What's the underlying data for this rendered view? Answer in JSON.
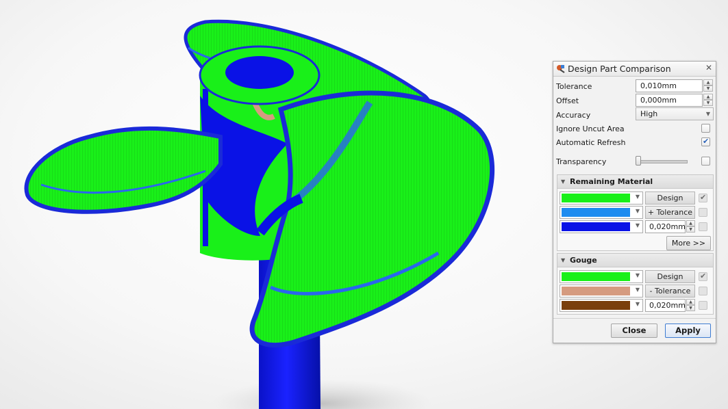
{
  "dialog": {
    "title": "Design Part Comparison",
    "tolerance": {
      "label": "Tolerance",
      "value": "0,010mm"
    },
    "offset": {
      "label": "Offset",
      "value": "0,000mm"
    },
    "accuracy": {
      "label": "Accuracy",
      "value": "High"
    },
    "ignore_uncut": {
      "label": "Ignore Uncut Area",
      "checked": false
    },
    "auto_refresh": {
      "label": "Automatic Refresh",
      "checked": true
    },
    "transparency": {
      "label": "Transparency",
      "level": 0.0,
      "checked": false
    },
    "remaining": {
      "title": "Remaining Material",
      "rows": [
        {
          "color": "#19f019",
          "label": "Design",
          "checked": true
        },
        {
          "color": "#1e8cf0",
          "label": "+ Tolerance",
          "checked": false
        },
        {
          "color": "#0a12e6",
          "value": "0,020mm",
          "checked": false
        }
      ],
      "more_label": "More >>"
    },
    "gouge": {
      "title": "Gouge",
      "rows": [
        {
          "color": "#19f019",
          "label": "Design",
          "checked": true
        },
        {
          "color": "#d59b80",
          "label": "- Tolerance",
          "checked": false
        },
        {
          "color": "#7a3f0c",
          "value": "0,020mm",
          "checked": false
        }
      ]
    },
    "close_label": "Close",
    "apply_label": "Apply"
  },
  "colors": {
    "design_green": "#19f019",
    "tolerance_blue": "#1e8cf0",
    "remaining_blue": "#0a12e6",
    "gouge_tan": "#d59b80",
    "gouge_brown": "#7a3f0c",
    "checkbox_blue": "#2a62b8"
  }
}
